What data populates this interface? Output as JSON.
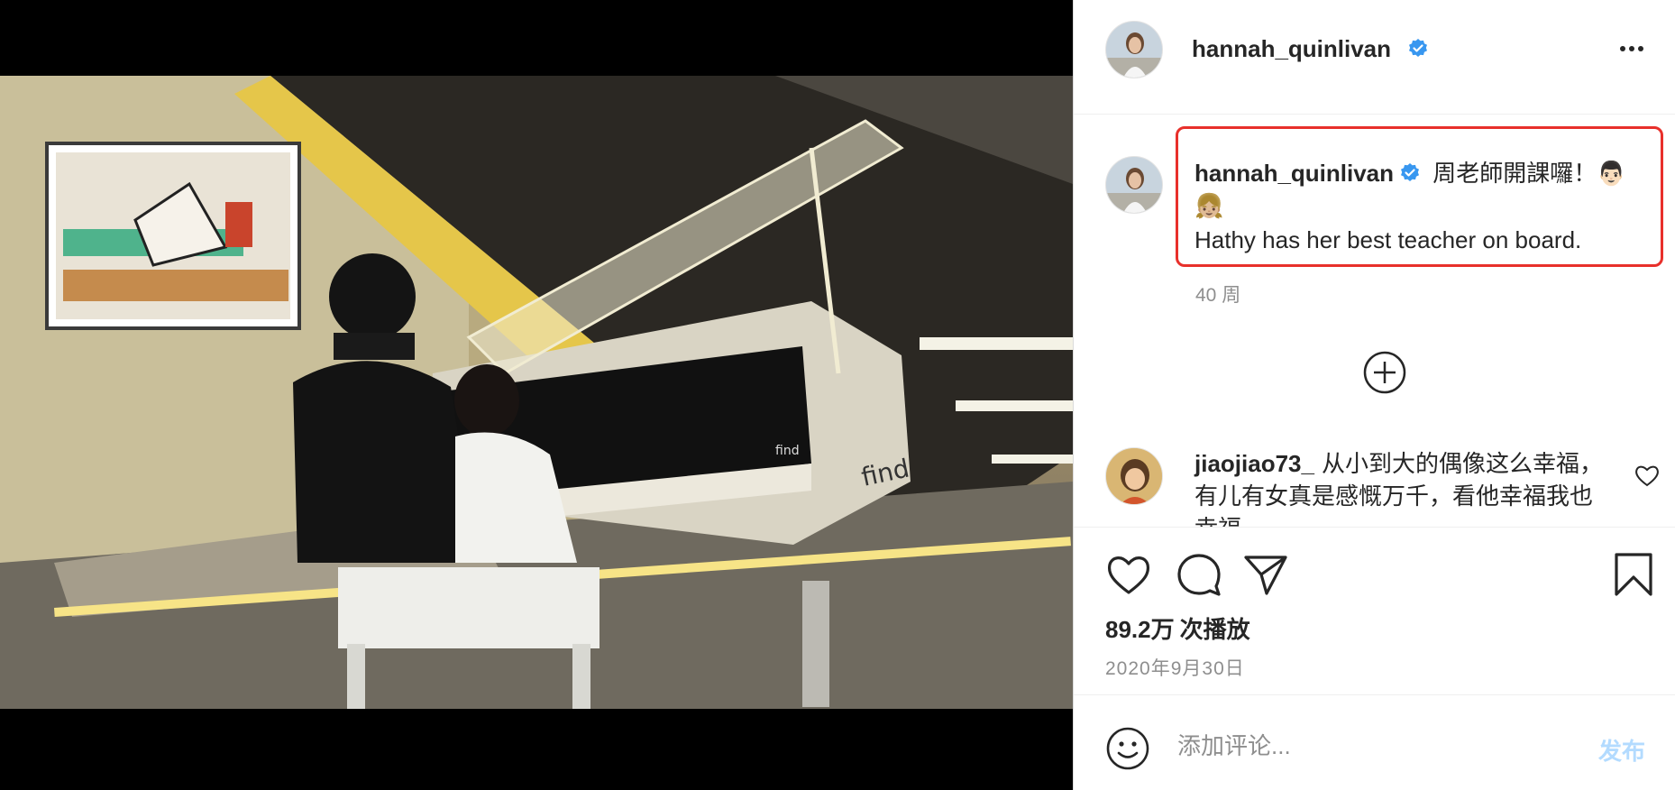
{
  "post": {
    "username": "hannah_quinlivan",
    "more_label": "更多选项"
  },
  "caption": {
    "username": "hannah_quinlivan",
    "text_line1": "周老師開課囉！👨🏻👧🏼",
    "text_line2": "Hathy has her best teacher on board.",
    "time_ago": "40 周"
  },
  "comments": [
    {
      "username": "jiaojiao73_",
      "text": "从小到大的偶像这么幸福，有儿有女真是感慨万千，看他幸福我也幸福"
    }
  ],
  "stats": {
    "views_number": "89.2万",
    "views_unit": "次播放",
    "date": "2020年9月30日"
  },
  "add_comment": {
    "placeholder": "添加评论...",
    "post_label": "发布"
  },
  "colors": {
    "verified_blue": "#3897f0",
    "highlight_red": "#e8302b",
    "post_button_disabled": "#b3dbff",
    "secondary_text": "#8e8e8e"
  },
  "icons": [
    "verified-badge-icon",
    "more-options-icon",
    "load-more-comments-icon",
    "heart-icon",
    "comment-icon",
    "share-icon",
    "bookmark-icon",
    "emoji-icon",
    "speaker-icon"
  ]
}
